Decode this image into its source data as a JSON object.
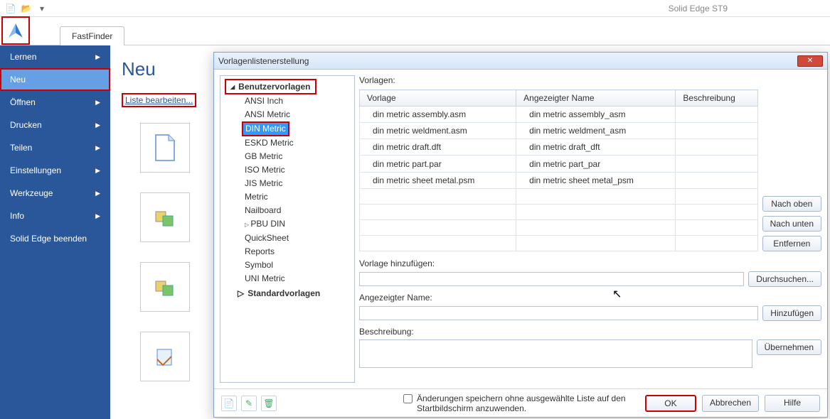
{
  "app": {
    "title": "Solid Edge ST9"
  },
  "ribbon_tab": "FastFinder",
  "sidebar": {
    "items": [
      {
        "label": "Lernen",
        "arrow": true
      },
      {
        "label": "Neu",
        "arrow": false,
        "active": true,
        "highlight": true
      },
      {
        "label": "Öffnen",
        "arrow": true
      },
      {
        "label": "Drucken",
        "arrow": true
      },
      {
        "label": "Teilen",
        "arrow": true
      },
      {
        "label": "Einstellungen",
        "arrow": true
      },
      {
        "label": "Werkzeuge",
        "arrow": true
      },
      {
        "label": "Info",
        "arrow": true
      },
      {
        "label": "Solid Edge beenden",
        "arrow": false
      }
    ]
  },
  "content": {
    "title": "Neu",
    "edit_link": "Liste bearbeiten..."
  },
  "dialog": {
    "title": "Vorlagenlistenerstellung",
    "tree": {
      "root1": "Benutzervorlagen",
      "children1": [
        "ANSI Inch",
        "ANSI Metric",
        "DIN Metric",
        "ESKD Metric",
        "GB Metric",
        "ISO Metric",
        "JIS Metric",
        "Metric",
        "Nailboard",
        "PBU DIN",
        "QuickSheet",
        "Reports",
        "Symbol",
        "UNI Metric"
      ],
      "selected": "DIN Metric",
      "root2": "Standardvorlagen"
    },
    "table": {
      "label": "Vorlagen:",
      "headers": [
        "Vorlage",
        "Angezeigter Name",
        "Beschreibung"
      ],
      "rows": [
        {
          "c0": "din metric assembly.asm",
          "c1": "din metric assembly_asm",
          "c2": ""
        },
        {
          "c0": "din metric weldment.asm",
          "c1": "din metric weldment_asm",
          "c2": ""
        },
        {
          "c0": "din metric draft.dft",
          "c1": "din metric draft_dft",
          "c2": ""
        },
        {
          "c0": "din metric part.par",
          "c1": "din metric part_par",
          "c2": ""
        },
        {
          "c0": "din metric sheet metal.psm",
          "c1": "din metric sheet metal_psm",
          "c2": ""
        }
      ]
    },
    "side_buttons": {
      "up": "Nach oben",
      "down": "Nach unten",
      "remove": "Entfernen"
    },
    "form": {
      "add_template_label": "Vorlage hinzufügen:",
      "browse": "Durchsuchen...",
      "display_name_label": "Angezeigter Name:",
      "add": "Hinzufügen",
      "description_label": "Beschreibung:",
      "apply": "Übernehmen"
    },
    "footer": {
      "checkbox_label": "Änderungen speichern ohne ausgewählte Liste auf den Startbildschirm anzuwenden.",
      "ok": "OK",
      "cancel": "Abbrechen",
      "help": "Hilfe"
    }
  }
}
